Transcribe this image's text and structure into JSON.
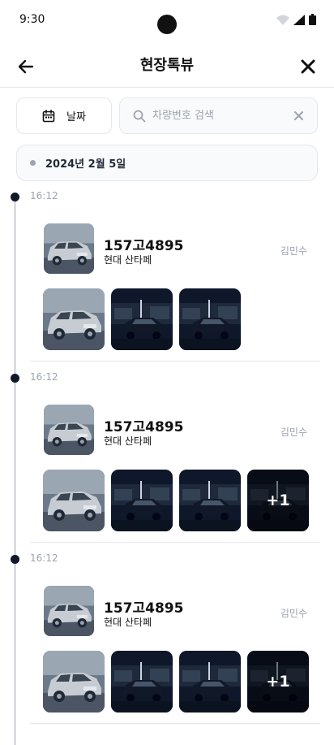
{
  "status_bar": {
    "time": "9:30"
  },
  "header": {
    "title": "현장톡뷰"
  },
  "filters": {
    "date_label": "날짜",
    "search_placeholder": "차량번호 검색",
    "search_value": ""
  },
  "date_banner": {
    "text": "2024년 2월 5일"
  },
  "entries": [
    {
      "time": "16:12",
      "plate": "157고4895",
      "model": "현대 산타페",
      "author": "김민수",
      "photos": [
        "car-silver-damaged",
        "car-dark-garage",
        "car-dark-garage"
      ],
      "more_label": ""
    },
    {
      "time": "16:12",
      "plate": "157고4895",
      "model": "현대 산타페",
      "author": "김민수",
      "photos": [
        "car-silver-damaged",
        "car-dark-garage",
        "car-dark-garage",
        "car-dark-garage"
      ],
      "more_label": "+1"
    },
    {
      "time": "16:12",
      "plate": "157고4895",
      "model": "현대 산타페",
      "author": "김민수",
      "photos": [
        "car-silver-damaged",
        "car-dark-garage",
        "car-dark-garage",
        "car-dark-garage"
      ],
      "more_label": "+1"
    }
  ],
  "colors": {
    "timeline_dot": "#111827",
    "muted_text": "#9ca3af",
    "border": "#e5e7eb"
  }
}
